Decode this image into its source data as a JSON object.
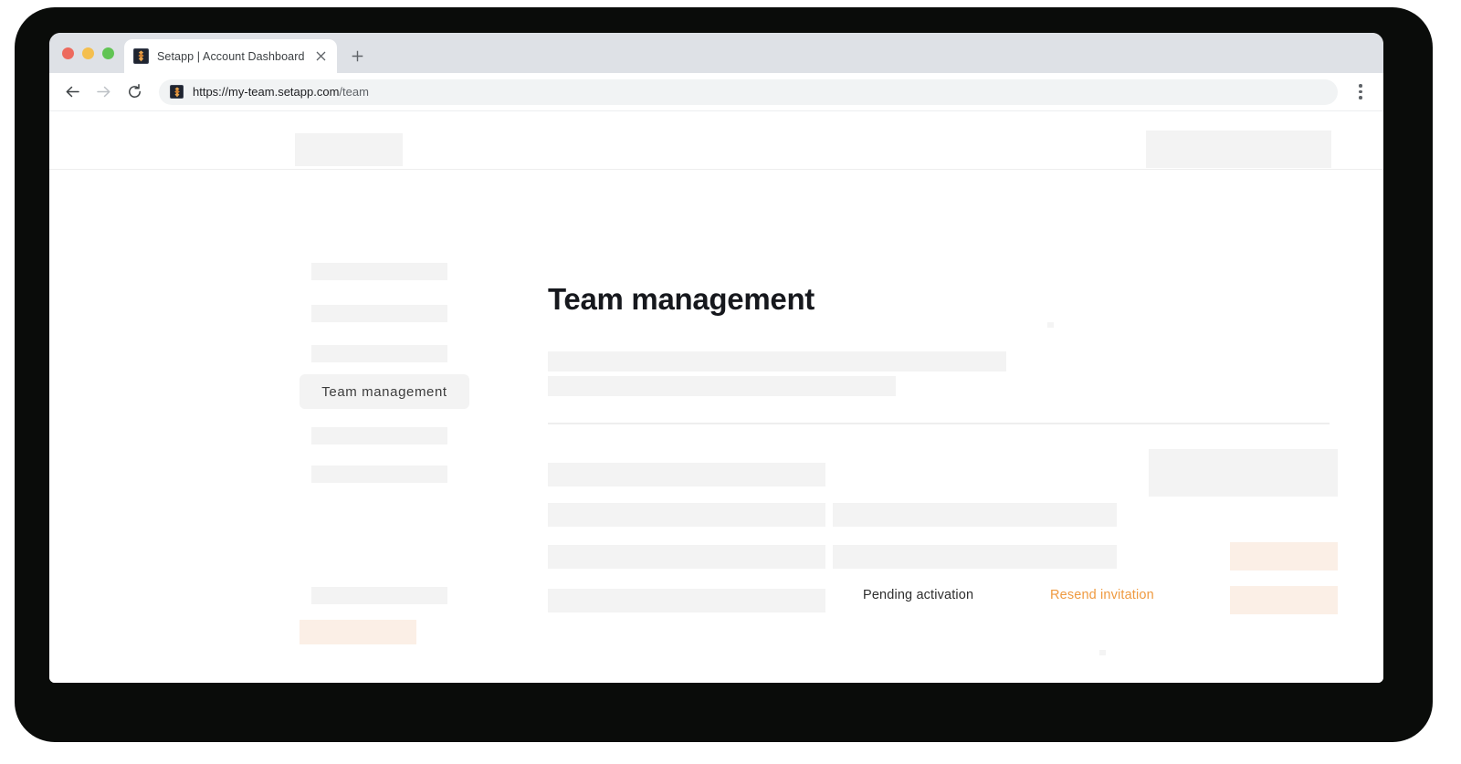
{
  "browser": {
    "tab": {
      "title": "Setapp | Account Dashboard",
      "close_label": "✕",
      "favicon_name": "setapp-favicon"
    },
    "new_tab_label": "+",
    "back_label": "←",
    "forward_label": "→",
    "reload_label": "⟳",
    "url_scheme": "https://",
    "url_host": "my-team.setapp.com",
    "url_path": "/team",
    "menu_label": "⋮"
  },
  "page": {
    "title": "Team management"
  },
  "sidebar": {
    "active_item_label": "Team management",
    "placeholder_items": [
      {
        "name": "sidebar-item-1"
      },
      {
        "name": "sidebar-item-2"
      },
      {
        "name": "sidebar-item-3"
      },
      {
        "name": "sidebar-item-5"
      },
      {
        "name": "sidebar-item-6"
      },
      {
        "name": "sidebar-item-7"
      }
    ]
  },
  "table": {
    "status_text": "Pending activation",
    "resend_link": "Resend invitation"
  },
  "colors": {
    "accent_orange": "#ef9a40",
    "orange_tint": "#fbefe6",
    "skeleton_gray": "#f3f3f3",
    "divider": "#eeeeee",
    "title_ink": "#16181d",
    "bezel": "#0a0c0a"
  }
}
